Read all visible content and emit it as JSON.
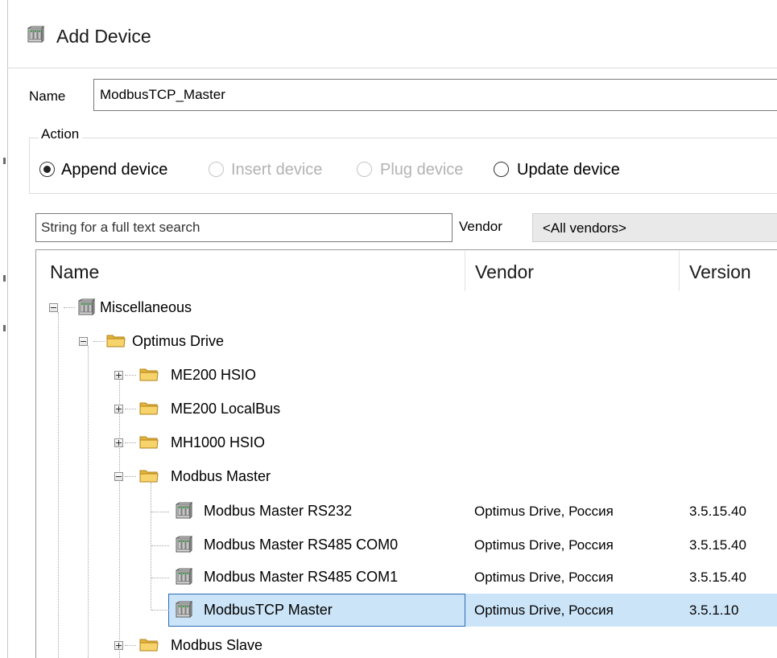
{
  "window": {
    "title": "Add Device",
    "icon": "device-icon"
  },
  "name_field": {
    "label": "Name",
    "value": "ModbusTCP_Master"
  },
  "action": {
    "legend": "Action",
    "options": [
      {
        "label": "Append device",
        "checked": true,
        "disabled": false
      },
      {
        "label": "Insert device",
        "checked": false,
        "disabled": true
      },
      {
        "label": "Plug device",
        "checked": false,
        "disabled": true
      },
      {
        "label": "Update device",
        "checked": false,
        "disabled": false
      }
    ]
  },
  "search": {
    "placeholder": "String for a full text search"
  },
  "vendor_filter": {
    "label": "Vendor",
    "selected": "<All vendors>"
  },
  "columns": {
    "name": "Name",
    "vendor": "Vendor",
    "version": "Version"
  },
  "tree": [
    {
      "name": "Miscellaneous",
      "type": "device",
      "expander": "minus"
    },
    {
      "name": "Optimus Drive",
      "type": "folder",
      "expander": "minus"
    },
    {
      "name": "ME200 HSIO",
      "type": "folder",
      "expander": "plus"
    },
    {
      "name": "ME200 LocalBus",
      "type": "folder",
      "expander": "plus"
    },
    {
      "name": "MH1000 HSIO",
      "type": "folder",
      "expander": "plus"
    },
    {
      "name": "Modbus Master",
      "type": "folder",
      "expander": "minus"
    },
    {
      "name": "Modbus Master RS232",
      "type": "device",
      "vendor": "Optimus Drive, Россия",
      "version": "3.5.15.40"
    },
    {
      "name": "Modbus Master RS485 COM0",
      "type": "device",
      "vendor": "Optimus Drive, Россия",
      "version": "3.5.15.40"
    },
    {
      "name": "Modbus Master RS485 COM1",
      "type": "device",
      "vendor": "Optimus Drive, Россия",
      "version": "3.5.15.40"
    },
    {
      "name": "ModbusTCP Master",
      "type": "device",
      "vendor": "Optimus Drive, Россия",
      "version": "3.5.1.10",
      "selected": true
    },
    {
      "name": "Modbus Slave",
      "type": "folder",
      "expander": "plus"
    }
  ],
  "colors": {
    "selection": "#cce4f7",
    "selection_border": "#2b6cb5",
    "folder": "#f0c24b"
  }
}
